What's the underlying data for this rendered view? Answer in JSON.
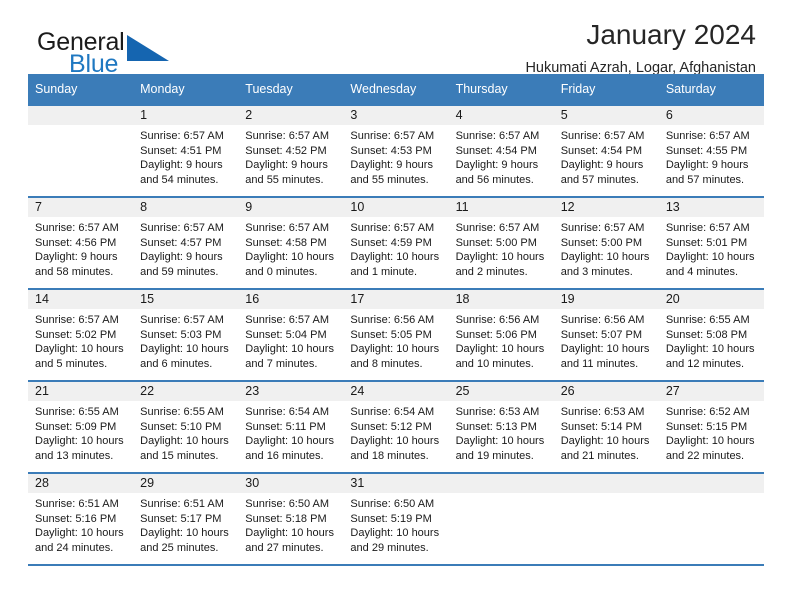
{
  "brand": {
    "name_part1": "General",
    "name_part2": "Blue",
    "logo_icon": "blue-triangle-icon"
  },
  "header": {
    "title": "January 2024",
    "subtitle": "Hukumati Azrah, Logar, Afghanistan"
  },
  "colors": {
    "header_blue": "#3b7cb8",
    "brand_blue": "#1f78c1",
    "day_band_gray": "#f0f0f0",
    "text": "#1a1a1a"
  },
  "calendar": {
    "day_headers": [
      "Sunday",
      "Monday",
      "Tuesday",
      "Wednesday",
      "Thursday",
      "Friday",
      "Saturday"
    ],
    "weeks": [
      [
        {
          "day": "",
          "lines": []
        },
        {
          "day": "1",
          "lines": [
            "Sunrise: 6:57 AM",
            "Sunset: 4:51 PM",
            "Daylight: 9 hours",
            "and 54 minutes."
          ]
        },
        {
          "day": "2",
          "lines": [
            "Sunrise: 6:57 AM",
            "Sunset: 4:52 PM",
            "Daylight: 9 hours",
            "and 55 minutes."
          ]
        },
        {
          "day": "3",
          "lines": [
            "Sunrise: 6:57 AM",
            "Sunset: 4:53 PM",
            "Daylight: 9 hours",
            "and 55 minutes."
          ]
        },
        {
          "day": "4",
          "lines": [
            "Sunrise: 6:57 AM",
            "Sunset: 4:54 PM",
            "Daylight: 9 hours",
            "and 56 minutes."
          ]
        },
        {
          "day": "5",
          "lines": [
            "Sunrise: 6:57 AM",
            "Sunset: 4:54 PM",
            "Daylight: 9 hours",
            "and 57 minutes."
          ]
        },
        {
          "day": "6",
          "lines": [
            "Sunrise: 6:57 AM",
            "Sunset: 4:55 PM",
            "Daylight: 9 hours",
            "and 57 minutes."
          ]
        }
      ],
      [
        {
          "day": "7",
          "lines": [
            "Sunrise: 6:57 AM",
            "Sunset: 4:56 PM",
            "Daylight: 9 hours",
            "and 58 minutes."
          ]
        },
        {
          "day": "8",
          "lines": [
            "Sunrise: 6:57 AM",
            "Sunset: 4:57 PM",
            "Daylight: 9 hours",
            "and 59 minutes."
          ]
        },
        {
          "day": "9",
          "lines": [
            "Sunrise: 6:57 AM",
            "Sunset: 4:58 PM",
            "Daylight: 10 hours",
            "and 0 minutes."
          ]
        },
        {
          "day": "10",
          "lines": [
            "Sunrise: 6:57 AM",
            "Sunset: 4:59 PM",
            "Daylight: 10 hours",
            "and 1 minute."
          ]
        },
        {
          "day": "11",
          "lines": [
            "Sunrise: 6:57 AM",
            "Sunset: 5:00 PM",
            "Daylight: 10 hours",
            "and 2 minutes."
          ]
        },
        {
          "day": "12",
          "lines": [
            "Sunrise: 6:57 AM",
            "Sunset: 5:00 PM",
            "Daylight: 10 hours",
            "and 3 minutes."
          ]
        },
        {
          "day": "13",
          "lines": [
            "Sunrise: 6:57 AM",
            "Sunset: 5:01 PM",
            "Daylight: 10 hours",
            "and 4 minutes."
          ]
        }
      ],
      [
        {
          "day": "14",
          "lines": [
            "Sunrise: 6:57 AM",
            "Sunset: 5:02 PM",
            "Daylight: 10 hours",
            "and 5 minutes."
          ]
        },
        {
          "day": "15",
          "lines": [
            "Sunrise: 6:57 AM",
            "Sunset: 5:03 PM",
            "Daylight: 10 hours",
            "and 6 minutes."
          ]
        },
        {
          "day": "16",
          "lines": [
            "Sunrise: 6:57 AM",
            "Sunset: 5:04 PM",
            "Daylight: 10 hours",
            "and 7 minutes."
          ]
        },
        {
          "day": "17",
          "lines": [
            "Sunrise: 6:56 AM",
            "Sunset: 5:05 PM",
            "Daylight: 10 hours",
            "and 8 minutes."
          ]
        },
        {
          "day": "18",
          "lines": [
            "Sunrise: 6:56 AM",
            "Sunset: 5:06 PM",
            "Daylight: 10 hours",
            "and 10 minutes."
          ]
        },
        {
          "day": "19",
          "lines": [
            "Sunrise: 6:56 AM",
            "Sunset: 5:07 PM",
            "Daylight: 10 hours",
            "and 11 minutes."
          ]
        },
        {
          "day": "20",
          "lines": [
            "Sunrise: 6:55 AM",
            "Sunset: 5:08 PM",
            "Daylight: 10 hours",
            "and 12 minutes."
          ]
        }
      ],
      [
        {
          "day": "21",
          "lines": [
            "Sunrise: 6:55 AM",
            "Sunset: 5:09 PM",
            "Daylight: 10 hours",
            "and 13 minutes."
          ]
        },
        {
          "day": "22",
          "lines": [
            "Sunrise: 6:55 AM",
            "Sunset: 5:10 PM",
            "Daylight: 10 hours",
            "and 15 minutes."
          ]
        },
        {
          "day": "23",
          "lines": [
            "Sunrise: 6:54 AM",
            "Sunset: 5:11 PM",
            "Daylight: 10 hours",
            "and 16 minutes."
          ]
        },
        {
          "day": "24",
          "lines": [
            "Sunrise: 6:54 AM",
            "Sunset: 5:12 PM",
            "Daylight: 10 hours",
            "and 18 minutes."
          ]
        },
        {
          "day": "25",
          "lines": [
            "Sunrise: 6:53 AM",
            "Sunset: 5:13 PM",
            "Daylight: 10 hours",
            "and 19 minutes."
          ]
        },
        {
          "day": "26",
          "lines": [
            "Sunrise: 6:53 AM",
            "Sunset: 5:14 PM",
            "Daylight: 10 hours",
            "and 21 minutes."
          ]
        },
        {
          "day": "27",
          "lines": [
            "Sunrise: 6:52 AM",
            "Sunset: 5:15 PM",
            "Daylight: 10 hours",
            "and 22 minutes."
          ]
        }
      ],
      [
        {
          "day": "28",
          "lines": [
            "Sunrise: 6:51 AM",
            "Sunset: 5:16 PM",
            "Daylight: 10 hours",
            "and 24 minutes."
          ]
        },
        {
          "day": "29",
          "lines": [
            "Sunrise: 6:51 AM",
            "Sunset: 5:17 PM",
            "Daylight: 10 hours",
            "and 25 minutes."
          ]
        },
        {
          "day": "30",
          "lines": [
            "Sunrise: 6:50 AM",
            "Sunset: 5:18 PM",
            "Daylight: 10 hours",
            "and 27 minutes."
          ]
        },
        {
          "day": "31",
          "lines": [
            "Sunrise: 6:50 AM",
            "Sunset: 5:19 PM",
            "Daylight: 10 hours",
            "and 29 minutes."
          ]
        },
        {
          "day": "",
          "lines": []
        },
        {
          "day": "",
          "lines": []
        },
        {
          "day": "",
          "lines": []
        }
      ]
    ]
  }
}
